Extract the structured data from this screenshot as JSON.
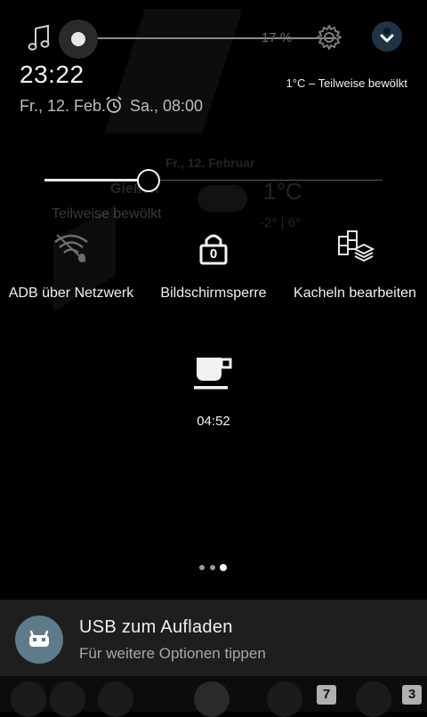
{
  "header": {
    "volume_percent": "17 %",
    "volume_level": 0.17,
    "clock": "23:22",
    "date": "Fr., 12. Feb.",
    "alarm": "Sa., 08:00",
    "weather_status": "1°C – Teilweise bewölkt"
  },
  "background_widget": {
    "date": "Fr., 12. Februar",
    "city": "Gießen",
    "condition": "Teilweise bewölkt",
    "temperature": "1°C",
    "range": "-2° | 6°"
  },
  "brightness": {
    "level": 0.33
  },
  "tiles": [
    {
      "label": "ADB über Netzwerk",
      "icon": "adb-network-icon"
    },
    {
      "label": "Bildschirmsperre",
      "icon": "screen-lock-icon",
      "badge": "0"
    },
    {
      "label": "Kacheln bearbeiten",
      "icon": "edit-tiles-icon"
    },
    {
      "label": "04:52",
      "icon": "caffeine-icon"
    }
  ],
  "pager": {
    "pages": 3,
    "active": 3
  },
  "notification": {
    "title": "USB zum Aufladen",
    "text": "Für weitere Optionen tippen",
    "icon": "robot-icon"
  },
  "dock": {
    "badge_messages": "7",
    "badge_phone": "3"
  },
  "colors": {
    "background": "#000000",
    "notification_bg": "#1e1e1e",
    "accent_dark_blue": "#1f3344",
    "avatar": "#5f7b8a"
  }
}
